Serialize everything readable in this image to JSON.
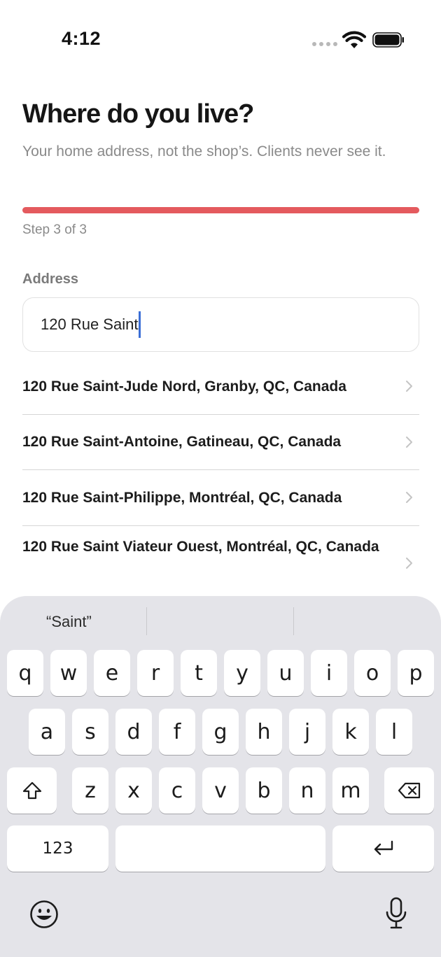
{
  "status_bar": {
    "time": "4:12"
  },
  "header": {
    "title": "Where do you live?",
    "subtitle": "Your home address, not the shop’s. Clients never see it."
  },
  "progress": {
    "fraction": 1.0,
    "step_label": "Step 3 of 3",
    "color": "#e45a5e"
  },
  "address": {
    "label": "Address",
    "value": "120 Rue Saint"
  },
  "suggestions": [
    "120 Rue Saint-Jude Nord, Granby, QC, Canada",
    "120 Rue Saint-Antoine, Gatineau, QC, Canada",
    "120 Rue Saint-Philippe, Montréal, QC, Canada",
    "120 Rue Saint Viateur Ouest, Montréal, QC, Canada"
  ],
  "keyboard": {
    "prediction": "“Saint”",
    "row1": [
      "q",
      "w",
      "e",
      "r",
      "t",
      "y",
      "u",
      "i",
      "o",
      "p"
    ],
    "row2": [
      "a",
      "s",
      "d",
      "f",
      "g",
      "h",
      "j",
      "k",
      "l"
    ],
    "row3": [
      "z",
      "x",
      "c",
      "v",
      "b",
      "n",
      "m"
    ],
    "numbers_key": "123",
    "icons": {
      "shift": "shift-icon",
      "delete": "delete-icon",
      "return": "return-icon",
      "emoji": "emoji-icon",
      "mic": "microphone-icon"
    }
  },
  "colors": {
    "accent": "#e45a5e",
    "caret": "#3b6fd6",
    "keyboard_bg": "#e4e4e9"
  }
}
